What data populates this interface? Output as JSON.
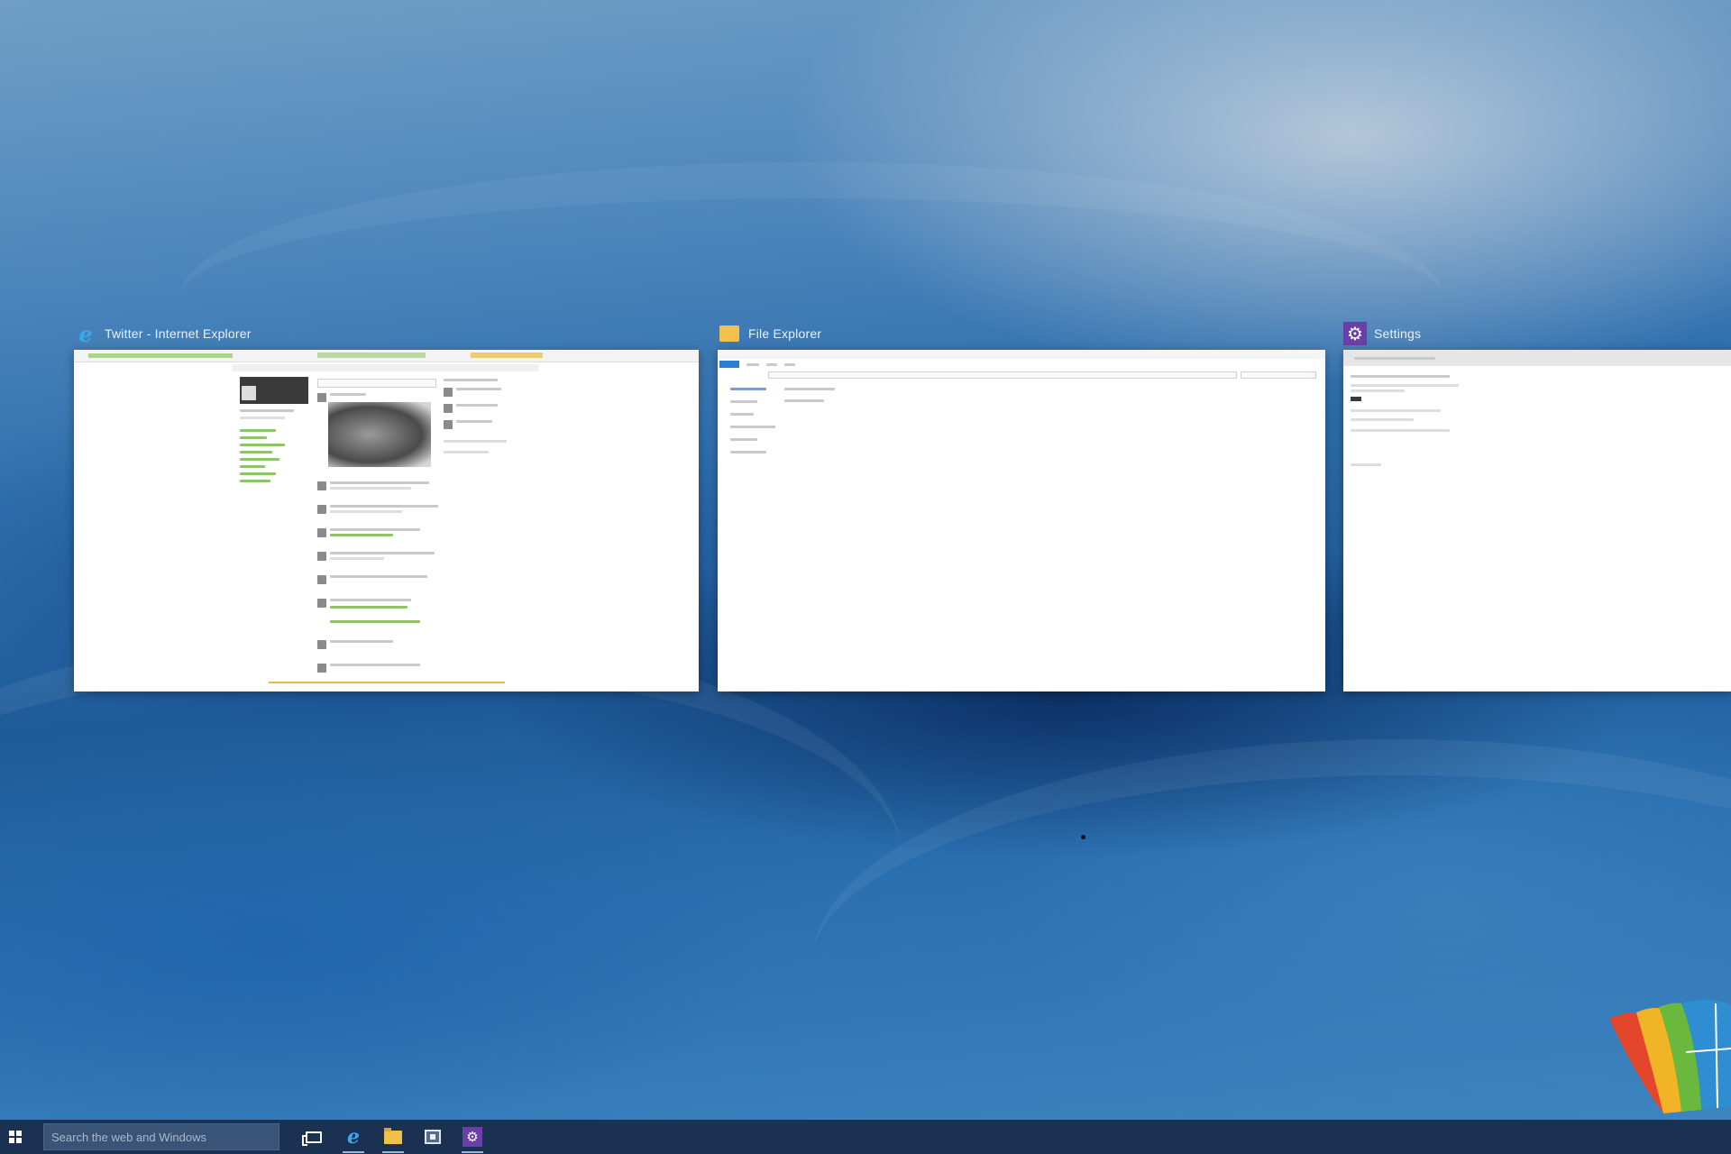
{
  "windows": [
    {
      "title": "Twitter - Internet Explorer",
      "icon": "internet-explorer-icon"
    },
    {
      "title": "File Explorer",
      "icon": "file-explorer-icon"
    },
    {
      "title": "Settings",
      "icon": "settings-icon"
    }
  ],
  "taskbar": {
    "search_placeholder": "Search the web and Windows",
    "icons": [
      "start-icon",
      "task-view-icon",
      "internet-explorer-icon",
      "file-explorer-icon",
      "store-icon",
      "settings-icon"
    ]
  },
  "colors": {
    "taskbar": "#1b3152",
    "search_box": "#3a5478",
    "settings_accent": "#6a3fa9",
    "ie_accent": "#3aa8ea",
    "folder": "#f1c04a"
  }
}
